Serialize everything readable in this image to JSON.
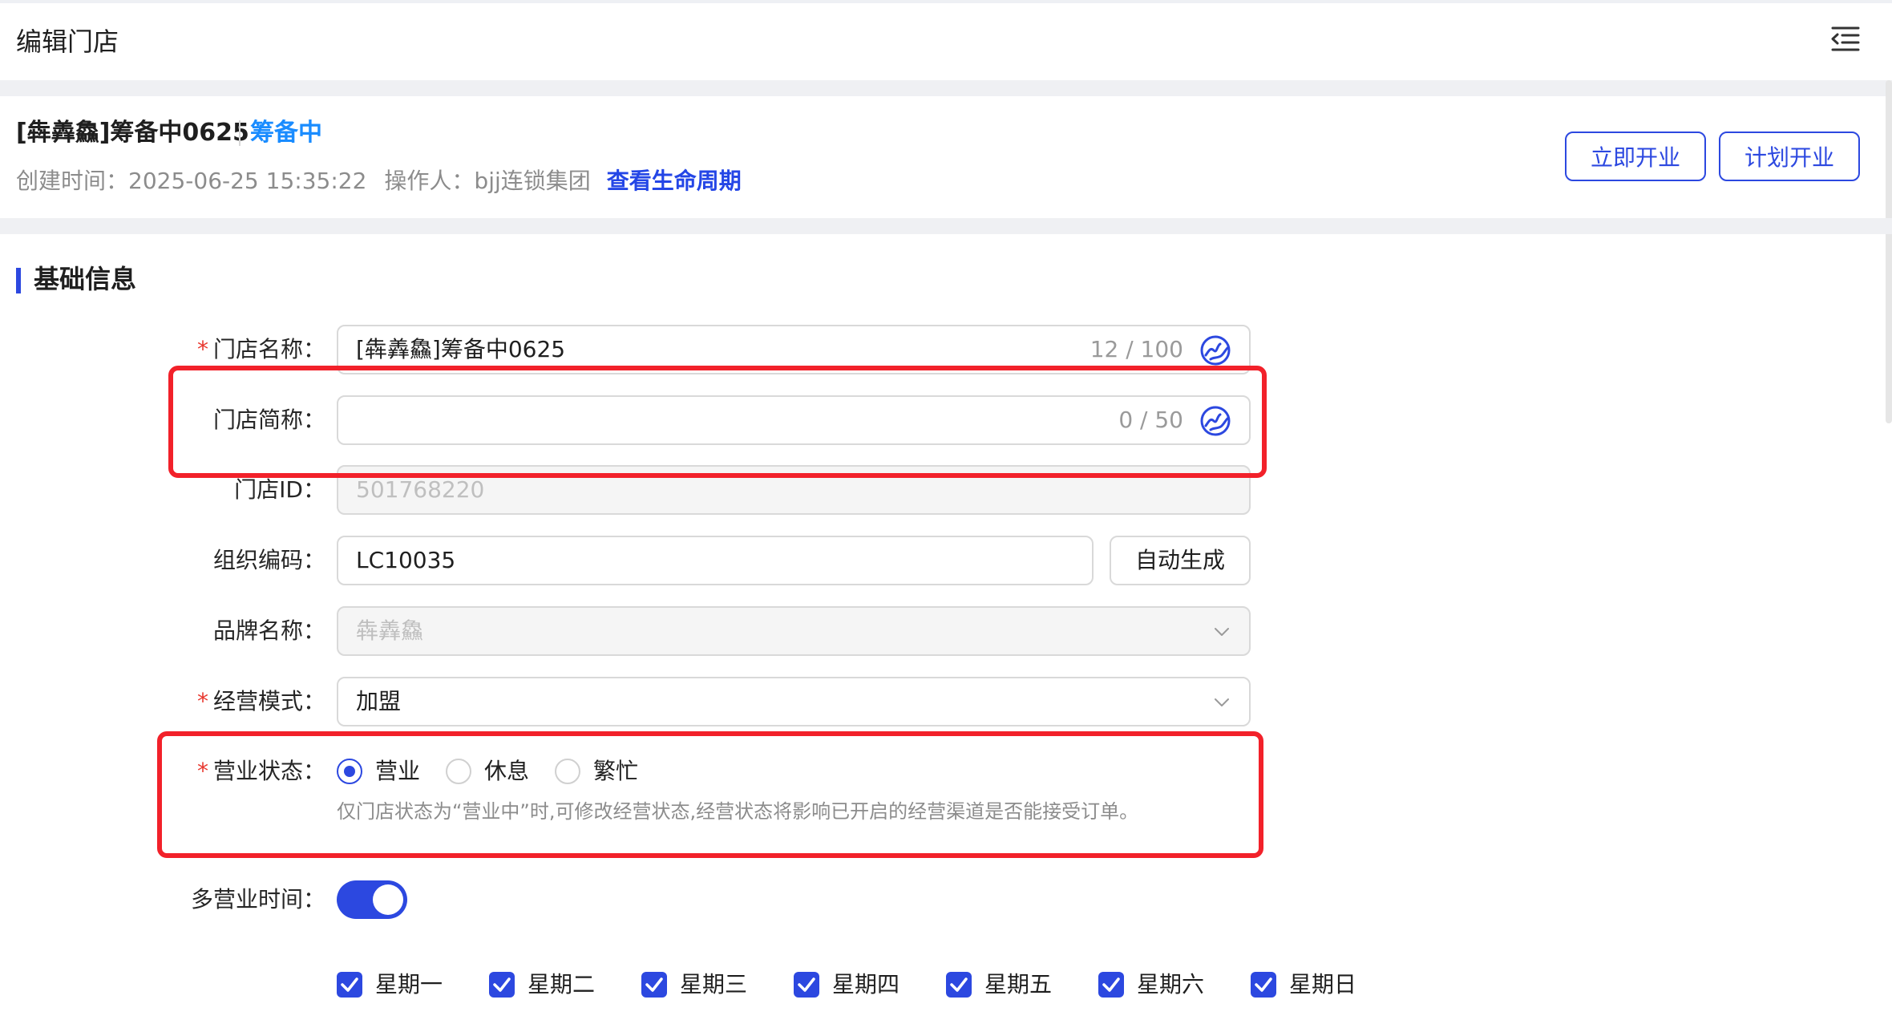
{
  "header": {
    "title": "编辑门店"
  },
  "store": {
    "name": "[犇羴鱻]筹备中0625",
    "status": "筹备中",
    "created_label": "创建时间：",
    "created_value": "2025-06-25 15:35:22",
    "operator_label": "操作人：",
    "operator_value": "bjj连锁集团",
    "lifecycle_link": "查看生命周期"
  },
  "actions": {
    "open_now": "立即开业",
    "plan_open": "计划开业"
  },
  "section": {
    "title": "基础信息"
  },
  "form": {
    "store_name": {
      "label": "门店名称：",
      "value": "[犇羴鱻]筹备中0625",
      "counter": "12 / 100"
    },
    "short_name": {
      "label": "门店简称：",
      "value": "",
      "counter": "0 / 50"
    },
    "store_id": {
      "label": "门店ID：",
      "value": "501768220"
    },
    "org_code": {
      "label": "组织编码：",
      "value": "LC10035",
      "button": "自动生成"
    },
    "brand": {
      "label": "品牌名称：",
      "value": "犇羴鱻"
    },
    "mode": {
      "label": "经营模式：",
      "value": "加盟"
    },
    "business_status": {
      "label": "营业状态：",
      "options": [
        "营业",
        "休息",
        "繁忙"
      ],
      "selected": "营业",
      "hint": "仅门店状态为“营业中”时,可修改经营状态,经营状态将影响已开启的经营渠道是否能接受订单。"
    },
    "multi_hours": {
      "label": "多营业时间：",
      "enabled": true
    },
    "days": [
      "星期一",
      "星期二",
      "星期三",
      "星期四",
      "星期五",
      "星期六",
      "星期日"
    ],
    "days_checked": [
      true,
      true,
      true,
      true,
      true,
      true,
      true
    ]
  },
  "colors": {
    "primary": "#2c48e0",
    "link": "#1a8cff",
    "required": "#e8372e",
    "highlight": "#f2212a"
  }
}
